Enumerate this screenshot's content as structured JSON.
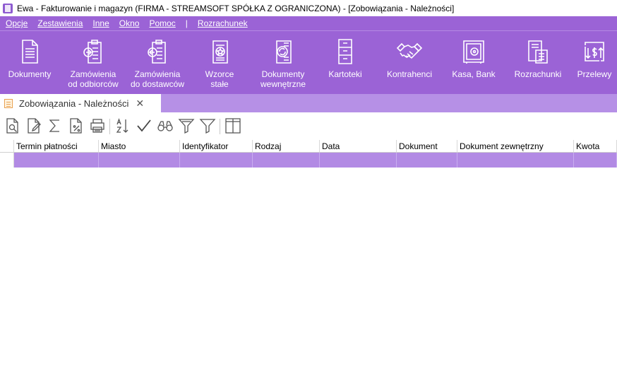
{
  "window": {
    "title": "Ewa - Fakturowanie i magazyn (FIRMA - STREAMSOFT SPÓŁKA Z OGRANICZONA) - [Zobowiązania - Należności]"
  },
  "menu": [
    "Opcje",
    "Zestawienia",
    "Inne",
    "Okno",
    "Pomoc",
    "|",
    "Rozrachunek"
  ],
  "ribbon": [
    {
      "label": "Dokumenty",
      "icon": "document-icon"
    },
    {
      "label": "Zamówienia\nod odbiorców",
      "icon": "order-in-icon"
    },
    {
      "label": "Zamówienia\ndo dostawców",
      "icon": "order-out-icon"
    },
    {
      "label": "Wzorce\nstałe",
      "icon": "template-icon"
    },
    {
      "label": "Dokumenty\nwewnętrzne",
      "icon": "internal-doc-icon"
    },
    {
      "label": "Kartoteki",
      "icon": "cabinet-icon"
    },
    {
      "label": "Kontrahenci",
      "icon": "handshake-icon"
    },
    {
      "label": "Kasa, Bank",
      "icon": "safe-icon"
    },
    {
      "label": "Rozrachunki",
      "icon": "settlement-icon"
    },
    {
      "label": "Przelewy",
      "icon": "transfer-icon"
    }
  ],
  "tab": {
    "label": "Zobowiązania - Należności",
    "close": "✕"
  },
  "toolbar": [
    "preview-icon",
    "edit-icon",
    "sum-icon",
    "percent-doc-icon",
    "print-icon",
    "sort-az-icon",
    "check-icon",
    "binoculars-icon",
    "filter-plus-icon",
    "filter-icon",
    "columns-icon"
  ],
  "grid": {
    "columns": [
      "Termin płatności",
      "Miasto",
      "Identyfikator",
      "Rodzaj",
      "Data",
      "Dokument",
      "Dokument zewnętrzny",
      "Kwota"
    ],
    "rows": [
      [
        "",
        "",
        "",
        "",
        "",
        "",
        "",
        ""
      ]
    ]
  },
  "colors": {
    "accent": "#9b63d6",
    "tabstrip": "#b690e6",
    "selected_row": "#b28ae4"
  }
}
